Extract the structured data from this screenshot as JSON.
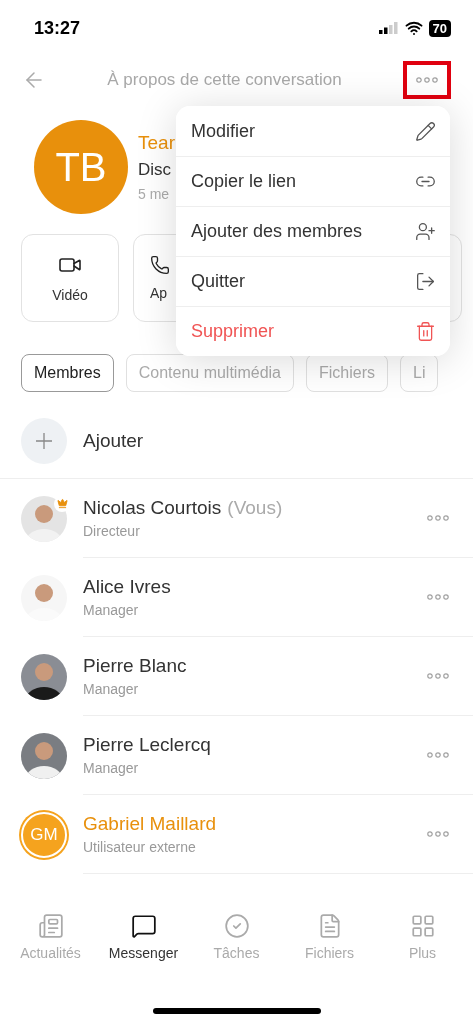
{
  "status_bar": {
    "time": "13:27",
    "battery": "70"
  },
  "header": {
    "title": "À propos de cette conversation",
    "more_highlighted": true
  },
  "group": {
    "initials": "TB",
    "name": "Tear",
    "description": "Disc",
    "meta": "5 me"
  },
  "action_cards": [
    {
      "kind": "video",
      "label": "Vidéo"
    },
    {
      "kind": "call",
      "label": "Ap"
    },
    {
      "kind": "blank"
    }
  ],
  "tabs": [
    {
      "label": "Membres",
      "selected": true
    },
    {
      "label": "Contenu multimédia",
      "selected": false
    },
    {
      "label": "Fichiers",
      "selected": false
    },
    {
      "label": "Li",
      "selected": false
    }
  ],
  "add_member": {
    "label": "Ajouter"
  },
  "members": [
    {
      "name": "Nicolas Courtois",
      "suffix": "(Vous)",
      "role": "Directeur",
      "admin": true,
      "external": false
    },
    {
      "name": "Alice Ivres",
      "role": "Manager",
      "external": false
    },
    {
      "name": "Pierre Blanc",
      "role": "Manager",
      "external": false
    },
    {
      "name": "Pierre Leclercq",
      "role": "Manager",
      "external": false
    },
    {
      "name": "Gabriel Maillard",
      "role": "Utilisateur externe",
      "initials": "GM",
      "external": true
    }
  ],
  "menu": [
    {
      "label": "Modifier",
      "kind": "edit",
      "danger": false
    },
    {
      "label": "Copier le lien",
      "kind": "link",
      "danger": false
    },
    {
      "label": "Ajouter des membres",
      "kind": "add-user",
      "danger": false
    },
    {
      "label": "Quitter",
      "kind": "leave",
      "danger": false
    },
    {
      "label": "Supprimer",
      "kind": "delete",
      "danger": true
    }
  ],
  "bottom_nav": [
    {
      "label": "Actualités",
      "kind": "news",
      "selected": false
    },
    {
      "label": "Messenger",
      "kind": "chat",
      "selected": true
    },
    {
      "label": "Tâches",
      "kind": "tasks",
      "selected": false
    },
    {
      "label": "Fichiers",
      "kind": "files",
      "selected": false
    },
    {
      "label": "Plus",
      "kind": "more",
      "selected": false
    }
  ]
}
